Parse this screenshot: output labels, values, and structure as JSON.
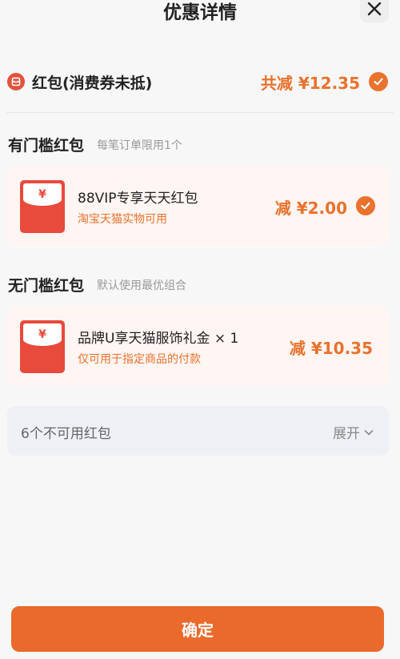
{
  "header": {
    "title": "优惠详情",
    "close_icon": "close-icon"
  },
  "summary": {
    "label": "红包(消费券未抵)",
    "total": "共减 ¥12.35",
    "icon": "red-packet-icon"
  },
  "threshold_section": {
    "title": "有门槛红包",
    "subtitle": "每笔订单限用1个",
    "item": {
      "symbol": "¥",
      "name": "88VIP专享天天红包",
      "desc": "淘宝天猫实物可用",
      "amount": "减 ¥2.00"
    }
  },
  "no_threshold_section": {
    "title": "无门槛红包",
    "subtitle": "默认使用最优组合",
    "item": {
      "symbol": "¥",
      "name": "品牌U享天猫服饰礼金 × 1",
      "desc": "仅可用于指定商品的付款",
      "amount": "减 ¥10.35"
    }
  },
  "unavailable": {
    "label": "6个不可用红包",
    "expand": "展开"
  },
  "confirm_button": "确定",
  "colors": {
    "accent": "#e9722d",
    "red": "#e84a3c",
    "card_bg": "#fff5f2",
    "page_bg": "#f7f7f8"
  }
}
